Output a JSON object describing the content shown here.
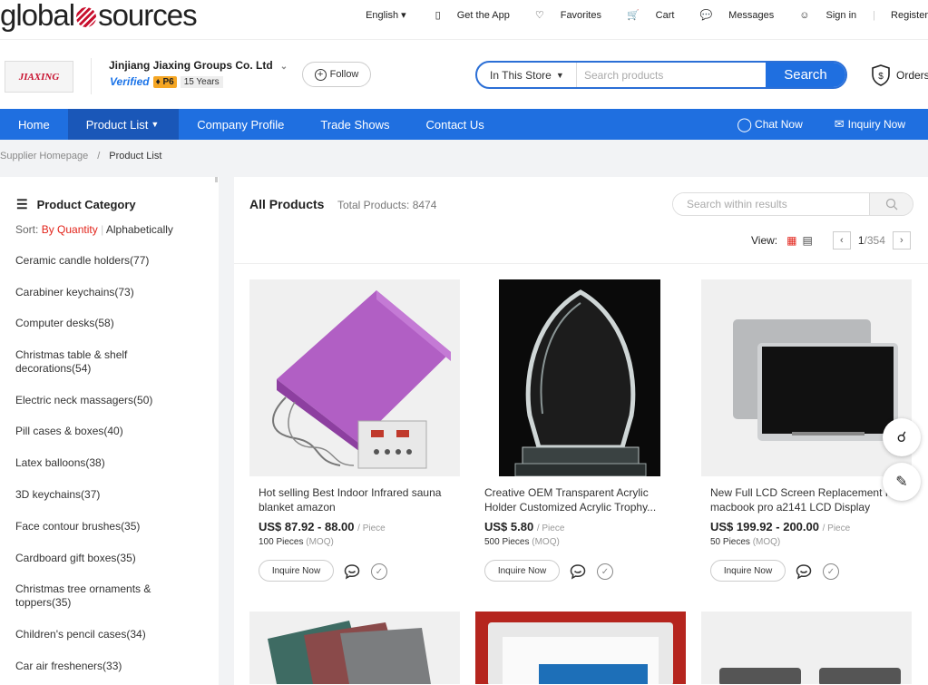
{
  "brand": {
    "logo_left": "global",
    "logo_right": "sources"
  },
  "toplinks": [
    {
      "label": "English",
      "icon": "chevron-down-icon"
    },
    {
      "label": "Get the App",
      "icon": "phone-icon"
    },
    {
      "label": "Favorites",
      "icon": "heart-icon"
    },
    {
      "label": "Cart",
      "icon": "cart-icon"
    },
    {
      "label": "Messages",
      "icon": "message-icon"
    },
    {
      "label": "Sign in",
      "icon": "user-icon"
    },
    {
      "label": "Register",
      "icon": ""
    }
  ],
  "store": {
    "logo_text": "JIAXING",
    "company_name": "Jinjiang Jiaxing Groups Co. Ltd",
    "verified": "Verified",
    "level": "P6",
    "years": "15 Years",
    "follow": "Follow"
  },
  "search": {
    "scope": "In This Store",
    "placeholder": "Search products",
    "button": "Search"
  },
  "orders": "Orders",
  "nav": {
    "items": [
      "Home",
      "Product List",
      "Company Profile",
      "Trade Shows",
      "Contact Us"
    ],
    "chat": "Chat Now",
    "inquiry": "Inquiry Now"
  },
  "breadcrumb": {
    "home": "Supplier Homepage",
    "sep": "/",
    "current": "Product List"
  },
  "sidebar": {
    "title": "Product Category",
    "sort_label": "Sort:",
    "sort_quantity": "By Quantity",
    "sort_sep": "|",
    "sort_alpha": "Alphabetically",
    "categories": [
      "Ceramic candle holders(77)",
      "Carabiner keychains(73)",
      "Computer desks(58)",
      "Christmas table & shelf decorations(54)",
      "Electric neck massagers(50)",
      "Pill cases & boxes(40)",
      "Latex balloons(38)",
      "3D keychains(37)",
      "Face contour brushes(35)",
      "Cardboard gift boxes(35)",
      "Christmas tree ornaments & toppers(35)",
      "Children's pencil cases(34)",
      "Car air fresheners(33)"
    ]
  },
  "main": {
    "title": "All Products",
    "total": "Total Products: 8474",
    "within_placeholder": "Search within results",
    "view_label": "View:",
    "page_current": "1",
    "page_total": "/354",
    "products": [
      {
        "title": "Hot selling Best Indoor Infrared sauna blanket amazon",
        "price": "US$ 87.92 - 88.00",
        "unit": "/ Piece",
        "moq": "100 Pieces",
        "moq_label": "(MOQ)",
        "inquire": "Inquire Now"
      },
      {
        "title": "Creative OEM Transparent Acrylic Holder Customized Acrylic Trophy...",
        "price": "US$ 5.80",
        "unit": "/ Piece",
        "moq": "500 Pieces",
        "moq_label": "(MOQ)",
        "inquire": "Inquire Now"
      },
      {
        "title": "New Full LCD Screen Replacement for macbook pro a2141 LCD Display",
        "price": "US$ 199.92 - 200.00",
        "unit": "/ Piece",
        "moq": "50 Pieces",
        "moq_label": "(MOQ)",
        "inquire": "Inquire Now"
      }
    ]
  }
}
